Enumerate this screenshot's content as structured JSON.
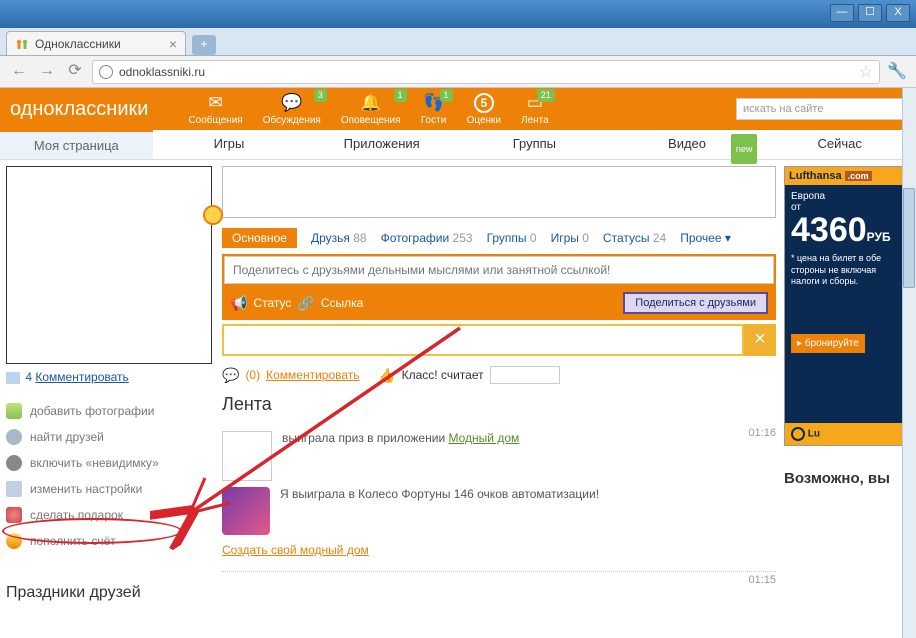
{
  "window": {
    "tab_title": "Одноклассники",
    "url": "odnoklassniki.ru"
  },
  "header": {
    "logo": "одноклассники",
    "items": [
      {
        "label": "Сообщения",
        "badge": null
      },
      {
        "label": "Обсуждения",
        "badge": "3"
      },
      {
        "label": "Оповещения",
        "badge": "1"
      },
      {
        "label": "Гости",
        "badge": "1"
      },
      {
        "label": "Оценки",
        "count": "5"
      },
      {
        "label": "Лента",
        "badge": "21"
      }
    ],
    "search_placeholder": "искать на сайте"
  },
  "subnav": {
    "items": [
      "Моя страница",
      "Игры",
      "Приложения",
      "Группы",
      "Видео",
      "Сейчас"
    ],
    "new_label": "new"
  },
  "sidebar": {
    "comment_count": "4",
    "comment_label": "Комментировать",
    "items": [
      "добавить фотографии",
      "найти друзей",
      "включить «невидимку»",
      "изменить настройки",
      "сделать подарок",
      "пополнить счёт"
    ],
    "section_title": "Праздники друзей"
  },
  "profile_tabs": {
    "main": "Основное",
    "items": [
      {
        "label": "Друзья",
        "n": "88"
      },
      {
        "label": "Фотографии",
        "n": "253"
      },
      {
        "label": "Группы",
        "n": "0"
      },
      {
        "label": "Игры",
        "n": "0"
      },
      {
        "label": "Статусы",
        "n": "24"
      }
    ],
    "more": "Прочее"
  },
  "share": {
    "placeholder": "Поделитесь с друзьями дельными мыслями или занятной ссылкой!",
    "status": "Статус",
    "link": "Ссылка",
    "button": "Поделиться с друзьями"
  },
  "meta": {
    "comment_n": "(0)",
    "comment": "Комментировать",
    "klass": "Класс! считает"
  },
  "feed": {
    "title": "Лента",
    "items": [
      {
        "time": "01:16",
        "text1": "выиграла приз в приложении ",
        "link1": "Модный дом",
        "text2": "Я выиграла в Колесо Фортуны 146 очков автоматизации!",
        "link2": "Создать свой модный дом"
      },
      {
        "time": "01:15"
      }
    ]
  },
  "ad": {
    "brand": "Lufthansa",
    "brand_ext": ".com",
    "l1": "Европа",
    "l2": "от",
    "price": "4360",
    "cur": "РУБ",
    "small": "* цена на билет в обе стороны не включая налоги и сборы.",
    "btn": "бронируйте",
    "logo": "Lu"
  },
  "right_title": "Возможно, вы"
}
